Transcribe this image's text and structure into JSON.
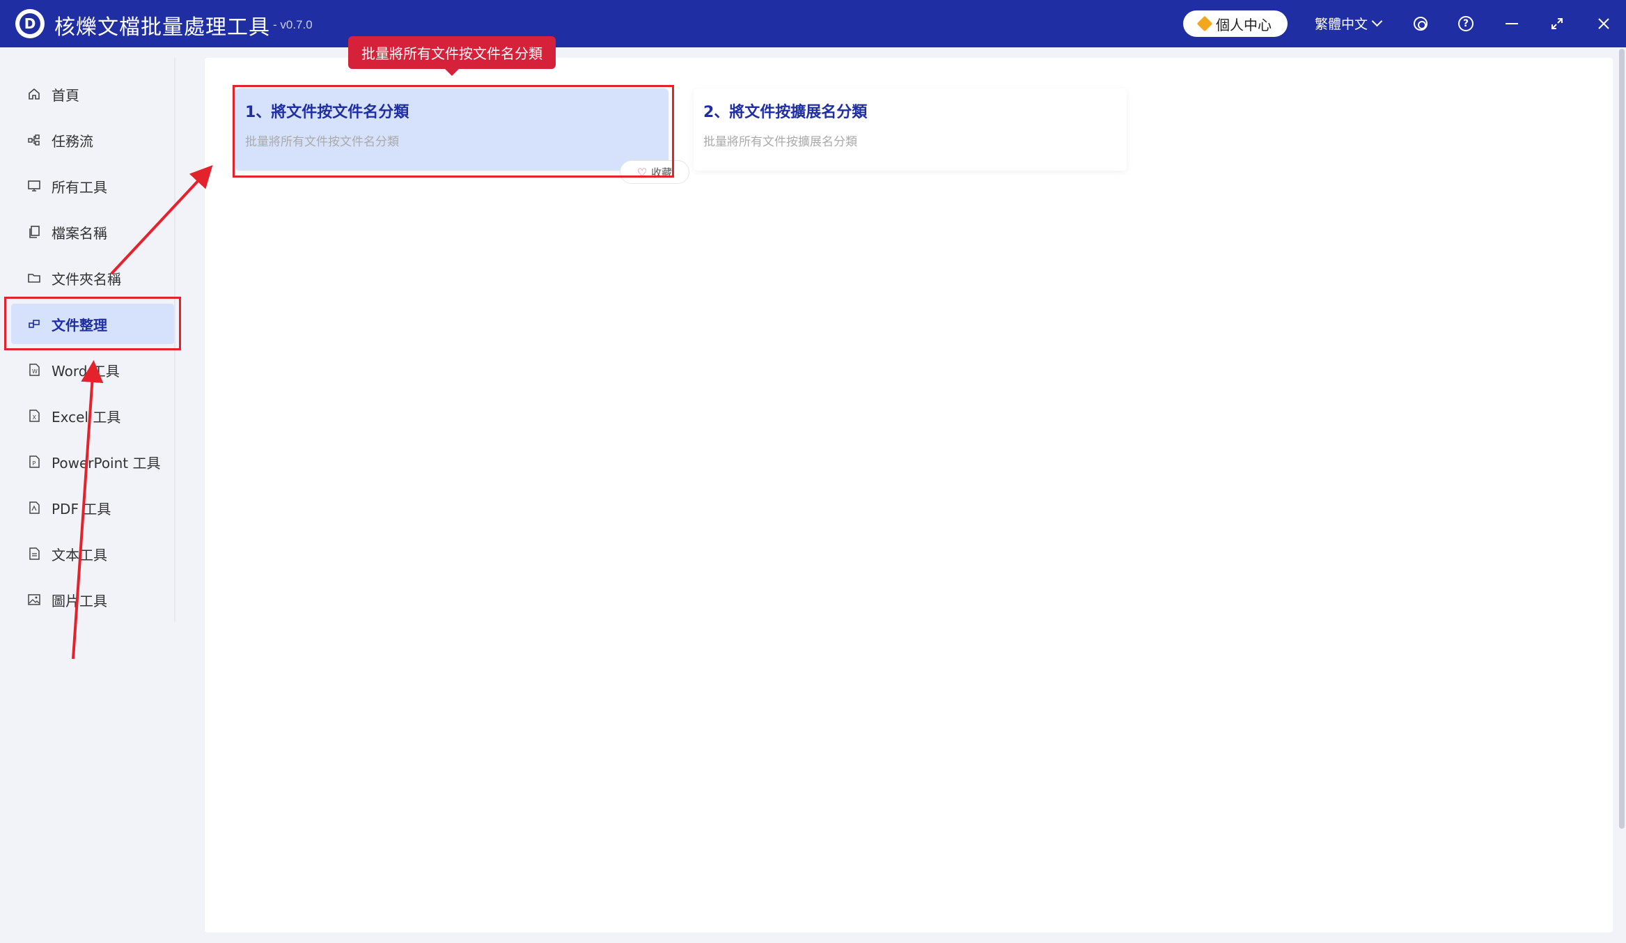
{
  "app": {
    "title": "核爍文檔批量處理工具",
    "version": "- v0.7.0",
    "logo_letter": "D"
  },
  "header": {
    "user_center": "個人中心",
    "language": "繁體中文",
    "icons": [
      "settings-icon",
      "help-icon",
      "minimize-icon",
      "maximize-icon",
      "close-icon"
    ]
  },
  "sidebar": {
    "items": [
      {
        "label": "首頁",
        "icon": "home-icon"
      },
      {
        "label": "任務流",
        "icon": "workflow-icon"
      },
      {
        "label": "所有工具",
        "icon": "monitor-icon"
      },
      {
        "label": "檔案名稱",
        "icon": "file-copy-icon"
      },
      {
        "label": "文件夾名稱",
        "icon": "folder-icon"
      },
      {
        "label": "文件整理",
        "icon": "organize-icon",
        "active": true
      },
      {
        "label": "Word 工具",
        "icon": "word-icon"
      },
      {
        "label": "Excel 工具",
        "icon": "excel-icon"
      },
      {
        "label": "PowerPoint 工具",
        "icon": "powerpoint-icon"
      },
      {
        "label": "PDF 工具",
        "icon": "pdf-icon"
      },
      {
        "label": "文本工具",
        "icon": "text-icon"
      },
      {
        "label": "圖片工具",
        "icon": "image-icon"
      }
    ]
  },
  "main": {
    "tooltip": "批量將所有文件按文件名分類",
    "cards": [
      {
        "title": "1、將文件按文件名分類",
        "desc": "批量將所有文件按文件名分類"
      },
      {
        "title": "2、將文件按擴展名分類",
        "desc": "批量將所有文件按擴展名分類"
      }
    ],
    "favorite_label": "收藏"
  },
  "colors": {
    "header_bg": "#1f2ea3",
    "active_bg": "#d6e2fb",
    "accent": "#1f2ea3",
    "annotation": "#e4222c",
    "tooltip_bg": "#d6213a"
  }
}
